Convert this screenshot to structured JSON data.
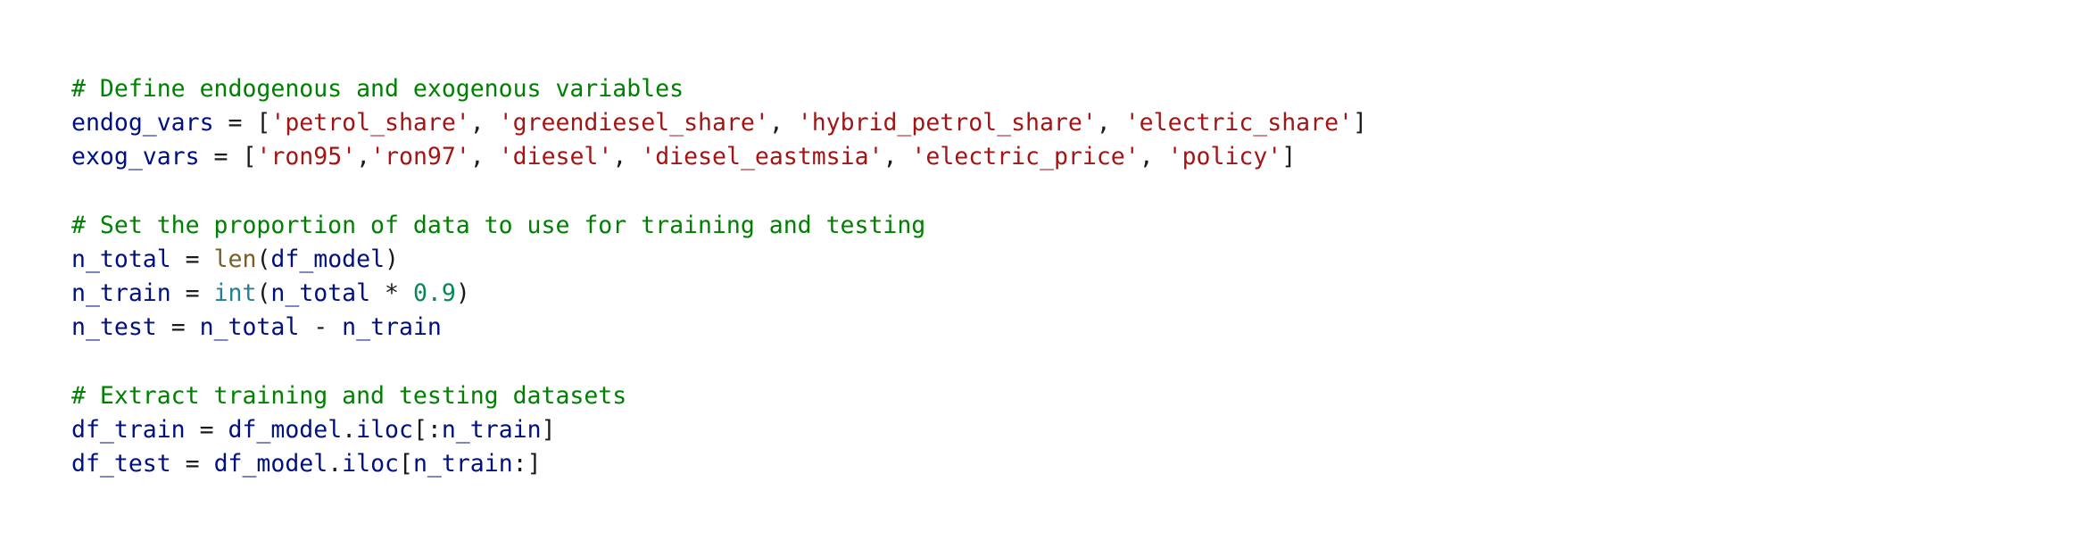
{
  "code": {
    "lines": [
      [
        {
          "t": "# Define endogenous and exogenous variables",
          "c": "comment"
        }
      ],
      [
        {
          "t": "endog_vars",
          "c": "var"
        },
        {
          "t": " = ",
          "c": "op"
        },
        {
          "t": "[",
          "c": "punct"
        },
        {
          "t": "'petrol_share'",
          "c": "string"
        },
        {
          "t": ", ",
          "c": "punct"
        },
        {
          "t": "'greendiesel_share'",
          "c": "string"
        },
        {
          "t": ", ",
          "c": "punct"
        },
        {
          "t": "'hybrid_petrol_share'",
          "c": "string"
        },
        {
          "t": ", ",
          "c": "punct"
        },
        {
          "t": "'electric_share'",
          "c": "string"
        },
        {
          "t": "]",
          "c": "punct"
        }
      ],
      [
        {
          "t": "exog_vars",
          "c": "var"
        },
        {
          "t": " = ",
          "c": "op"
        },
        {
          "t": "[",
          "c": "punct"
        },
        {
          "t": "'ron95'",
          "c": "string"
        },
        {
          "t": ",",
          "c": "punct"
        },
        {
          "t": "'ron97'",
          "c": "string"
        },
        {
          "t": ", ",
          "c": "punct"
        },
        {
          "t": "'diesel'",
          "c": "string"
        },
        {
          "t": ", ",
          "c": "punct"
        },
        {
          "t": "'diesel_eastmsia'",
          "c": "string"
        },
        {
          "t": ", ",
          "c": "punct"
        },
        {
          "t": "'electric_price'",
          "c": "string"
        },
        {
          "t": ", ",
          "c": "punct"
        },
        {
          "t": "'policy'",
          "c": "string"
        },
        {
          "t": "]",
          "c": "punct"
        }
      ],
      [],
      [
        {
          "t": "# Set the proportion of data to use for training and testing",
          "c": "comment"
        }
      ],
      [
        {
          "t": "n_total",
          "c": "var"
        },
        {
          "t": " = ",
          "c": "op"
        },
        {
          "t": "len",
          "c": "builtin"
        },
        {
          "t": "(",
          "c": "punct"
        },
        {
          "t": "df_model",
          "c": "var"
        },
        {
          "t": ")",
          "c": "punct"
        }
      ],
      [
        {
          "t": "n_train",
          "c": "var"
        },
        {
          "t": " = ",
          "c": "op"
        },
        {
          "t": "int",
          "c": "type"
        },
        {
          "t": "(",
          "c": "punct"
        },
        {
          "t": "n_total",
          "c": "var"
        },
        {
          "t": " * ",
          "c": "op"
        },
        {
          "t": "0.9",
          "c": "number"
        },
        {
          "t": ")",
          "c": "punct"
        }
      ],
      [
        {
          "t": "n_test",
          "c": "var"
        },
        {
          "t": " = ",
          "c": "op"
        },
        {
          "t": "n_total",
          "c": "var"
        },
        {
          "t": " - ",
          "c": "op"
        },
        {
          "t": "n_train",
          "c": "var"
        }
      ],
      [],
      [
        {
          "t": "# Extract training and testing datasets",
          "c": "comment"
        }
      ],
      [
        {
          "t": "df_train",
          "c": "var"
        },
        {
          "t": " = ",
          "c": "op"
        },
        {
          "t": "df_model",
          "c": "var"
        },
        {
          "t": ".",
          "c": "punct"
        },
        {
          "t": "iloc",
          "c": "var"
        },
        {
          "t": "[:",
          "c": "punct"
        },
        {
          "t": "n_train",
          "c": "var"
        },
        {
          "t": "]",
          "c": "punct"
        }
      ],
      [
        {
          "t": "df_test",
          "c": "var"
        },
        {
          "t": " = ",
          "c": "op"
        },
        {
          "t": "df_model",
          "c": "var"
        },
        {
          "t": ".",
          "c": "punct"
        },
        {
          "t": "iloc",
          "c": "var"
        },
        {
          "t": "[",
          "c": "punct"
        },
        {
          "t": "n_train",
          "c": "var"
        },
        {
          "t": ":]",
          "c": "punct"
        }
      ]
    ]
  }
}
